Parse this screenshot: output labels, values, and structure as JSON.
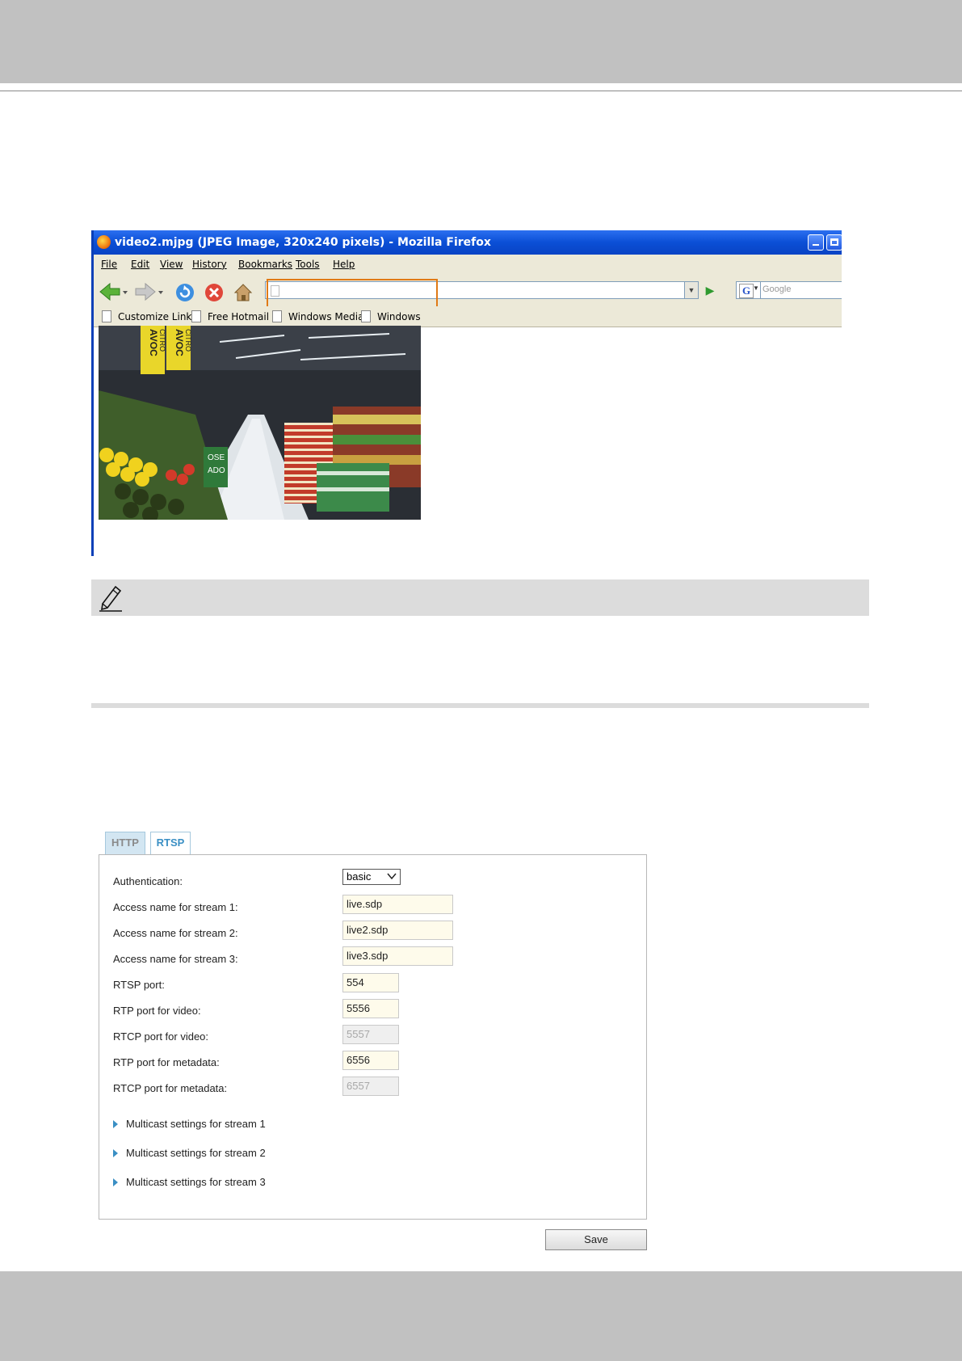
{
  "browser": {
    "title": "video2.mjpg (JPEG Image, 320x240 pixels) - Mozilla Firefox",
    "menu": [
      "File",
      "Edit",
      "View",
      "History",
      "Bookmarks",
      "Tools",
      "Help"
    ],
    "search_placeholder": "Google",
    "bookmarks": [
      "Customize Links",
      "Free Hotmail",
      "Windows Media",
      "Windows"
    ],
    "photo_signs": {
      "avoc1": "AVOC",
      "citroen1": "CITRO",
      "avoc2": "AVOC",
      "citroen2": "CITRO",
      "stand1": "OSE",
      "stand2": "ADO"
    }
  },
  "settings": {
    "tabs": [
      "HTTP",
      "RTSP"
    ],
    "active_tab": "RTSP",
    "fields": {
      "auth_label": "Authentication:",
      "auth_value": "basic",
      "stream1_label": "Access name for stream 1:",
      "stream1_value": "live.sdp",
      "stream2_label": "Access name for stream 2:",
      "stream2_value": "live2.sdp",
      "stream3_label": "Access name for stream 3:",
      "stream3_value": "live3.sdp",
      "rtsp_port_label": "RTSP port:",
      "rtsp_port_value": "554",
      "rtp_video_label": "RTP port for video:",
      "rtp_video_value": "5556",
      "rtcp_video_label": "RTCP port for video:",
      "rtcp_video_value": "5557",
      "rtp_meta_label": "RTP port for metadata:",
      "rtp_meta_value": "6556",
      "rtcp_meta_label": "RTCP port for metadata:",
      "rtcp_meta_value": "6557"
    },
    "multicast": [
      "Multicast settings for stream 1",
      "Multicast settings for stream 2",
      "Multicast settings for stream 3"
    ],
    "save_label": "Save"
  },
  "colors": {
    "page_band": "#c1c1c1",
    "note_bar": "#dcdcdc",
    "tab_accent": "#3a8fc4",
    "url_highlight": "#e07a16"
  }
}
